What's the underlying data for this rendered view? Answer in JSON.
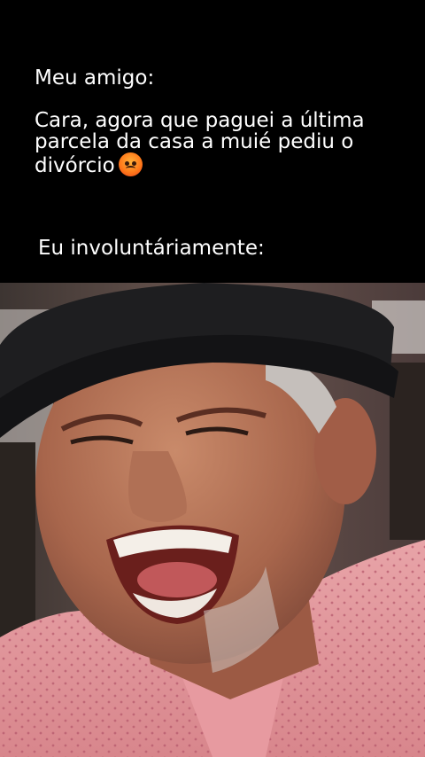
{
  "caption": {
    "speaker": "Meu amigo:",
    "line1": "Cara, agora que paguei a última",
    "line2": "parcela da casa a muié pediu o",
    "line3": "divórcio",
    "emoji": "angry-face-icon"
  },
  "reaction": {
    "label": "Eu involuntáriamente:"
  },
  "photo": {
    "description_icon": "laughing-man-photo"
  }
}
